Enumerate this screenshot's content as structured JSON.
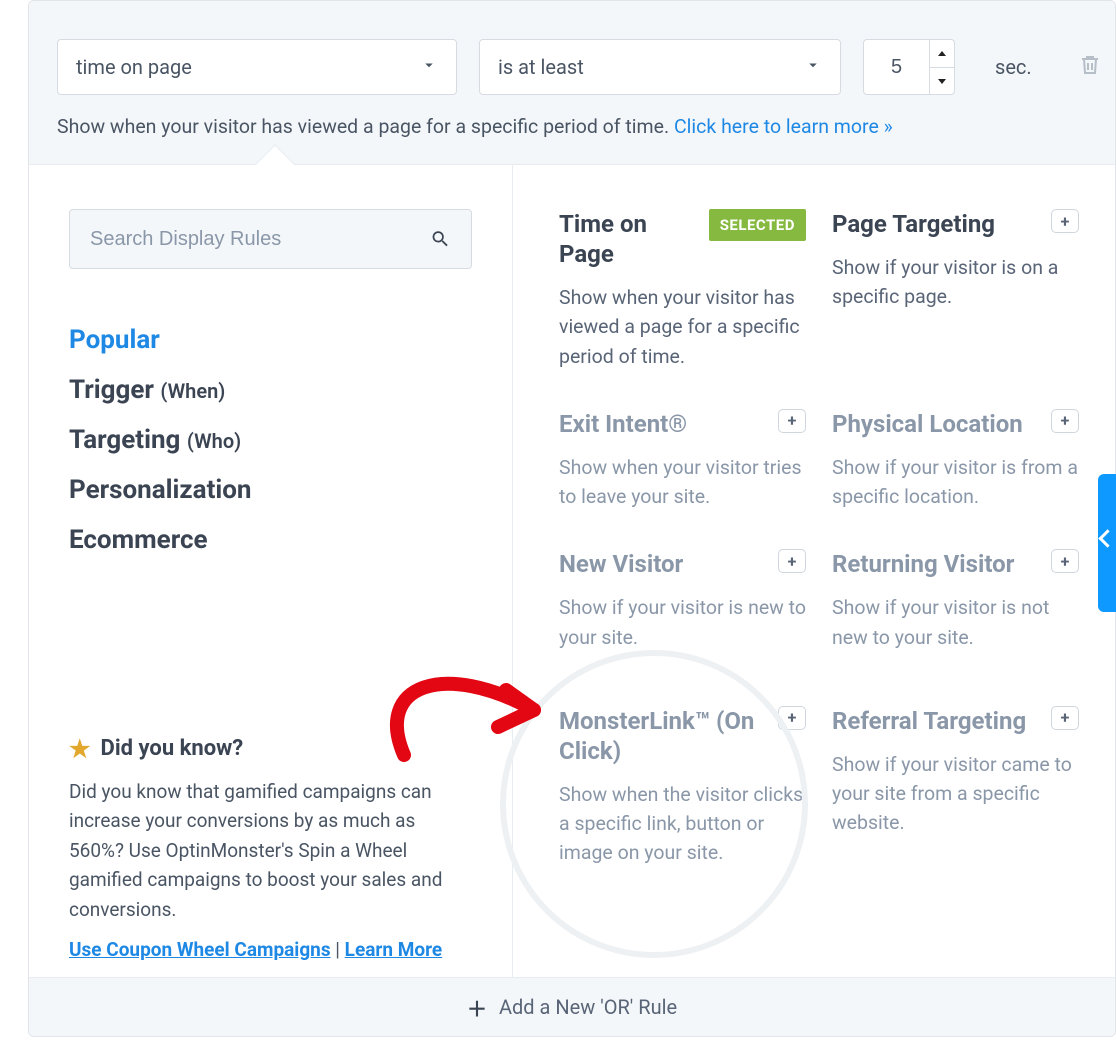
{
  "condition": {
    "type_label": "time on page",
    "operator_label": "is at least",
    "value": "5",
    "unit": "sec."
  },
  "help": {
    "text": "Show when your visitor has viewed a page for a specific period of time. ",
    "link": "Click here to learn more »"
  },
  "search": {
    "placeholder": "Search Display Rules"
  },
  "categories": [
    {
      "label": "Popular",
      "active": true
    },
    {
      "label": "Trigger",
      "sub": "(When)"
    },
    {
      "label": "Targeting",
      "sub": "(Who)"
    },
    {
      "label": "Personalization"
    },
    {
      "label": "Ecommerce"
    }
  ],
  "tip": {
    "heading": "Did you know?",
    "body": "Did you know that gamified campaigns can increase your conversions by as much as 560%? Use OptinMonster's Spin a Wheel gamified campaigns to boost your sales and conversions.",
    "link1": "Use Coupon Wheel Campaigns",
    "sep": " | ",
    "link2": "Learn More"
  },
  "badge_selected": "SELECTED",
  "rules": [
    {
      "title": "Time on Page",
      "desc": "Show when your visitor has viewed a page for a specific period of time.",
      "selected": true
    },
    {
      "title": "Page Targeting",
      "desc": "Show if your visitor is on a specific page."
    },
    {
      "title": "Exit Intent®",
      "desc": "Show when your visitor tries to leave your site.",
      "muted": true
    },
    {
      "title": "Physical Location",
      "desc": "Show if your visitor is from a specific location.",
      "muted": true
    },
    {
      "title": "New Visitor",
      "desc": "Show if your visitor is new to your site.",
      "muted": true
    },
    {
      "title": "Returning Visitor",
      "desc": "Show if your visitor is not new to your site.",
      "muted": true
    },
    {
      "title": "MonsterLink™ (On Click)",
      "desc": "Show when the visitor clicks a specific link, button or image on your site.",
      "muted": true
    },
    {
      "title": "Referral Targeting",
      "desc": "Show if your visitor came to your site from a specific website.",
      "muted": true
    }
  ],
  "footer": {
    "label": "Add a New 'OR' Rule"
  }
}
